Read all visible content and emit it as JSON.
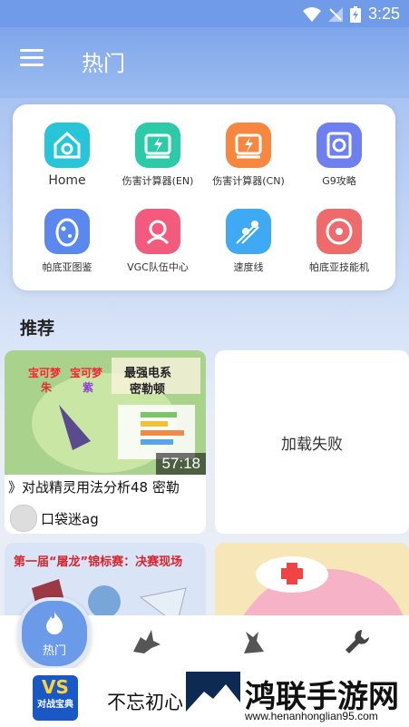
{
  "status": {
    "time": "3:25"
  },
  "header": {
    "title": "热门"
  },
  "tools": [
    {
      "label": "Home",
      "icon": "home-icon",
      "color": "#27c5d8"
    },
    {
      "label": "伤害计算器(EN)",
      "icon": "calculator-en-icon",
      "color": "#2ccaa8"
    },
    {
      "label": "伤害计算器(CN)",
      "icon": "calculator-cn-icon",
      "color": "#f7863f"
    },
    {
      "label": "G9攻略",
      "icon": "guide-icon",
      "color": "#6e7ff0"
    },
    {
      "label": "帕底亚图鉴",
      "icon": "egg-icon",
      "color": "#5b88ef"
    },
    {
      "label": "VGC队伍中心",
      "icon": "team-icon",
      "color": "#f25b7e"
    },
    {
      "label": "速度线",
      "icon": "speed-icon",
      "color": "#3fa9f3"
    },
    {
      "label": "帕底亚技能机",
      "icon": "disc-icon",
      "color": "#ef6a6a"
    }
  ],
  "recommend": {
    "heading": "推荐",
    "video1": {
      "thumb_text_top": "宝可梦",
      "thumb_text_top2": "宝可梦",
      "thumb_text_sub": "朱",
      "thumb_text_sub2": "紫",
      "thumb_title1": "最强电系",
      "thumb_title2": "密勒顿",
      "duration": "57:18",
      "title": "》对战精灵用法分析48 密勒",
      "uploader": "口袋迷ag"
    },
    "video2": {
      "status": "加载失败"
    },
    "video3": {
      "thumb_text": "第一届“屠龙”锦标赛：决赛现场"
    }
  },
  "nav": {
    "active_label": "热门"
  },
  "banner": {
    "logo_text": "VS",
    "logo_sub": "对战宝典",
    "slogan": "不忘初心",
    "watermark": "鸿联手游网",
    "watermark_url": "www.henanhonglian95.com"
  }
}
